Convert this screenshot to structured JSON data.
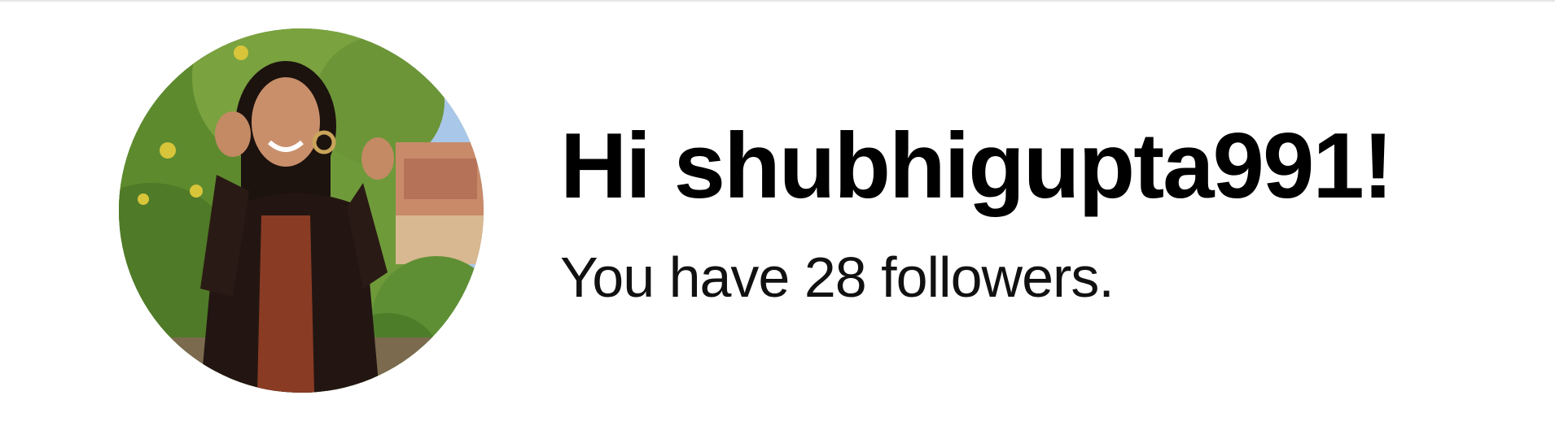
{
  "profile": {
    "greeting_prefix": "Hi",
    "username": "shubhigupta991",
    "greeting_suffix": "!",
    "greeting": "Hi shubhigupta991!",
    "followers_text": "You have 28 followers.",
    "followers_count": 28,
    "avatar_icon": "avatar-photo"
  },
  "colors": {
    "text": "#000000",
    "background": "#ffffff"
  }
}
